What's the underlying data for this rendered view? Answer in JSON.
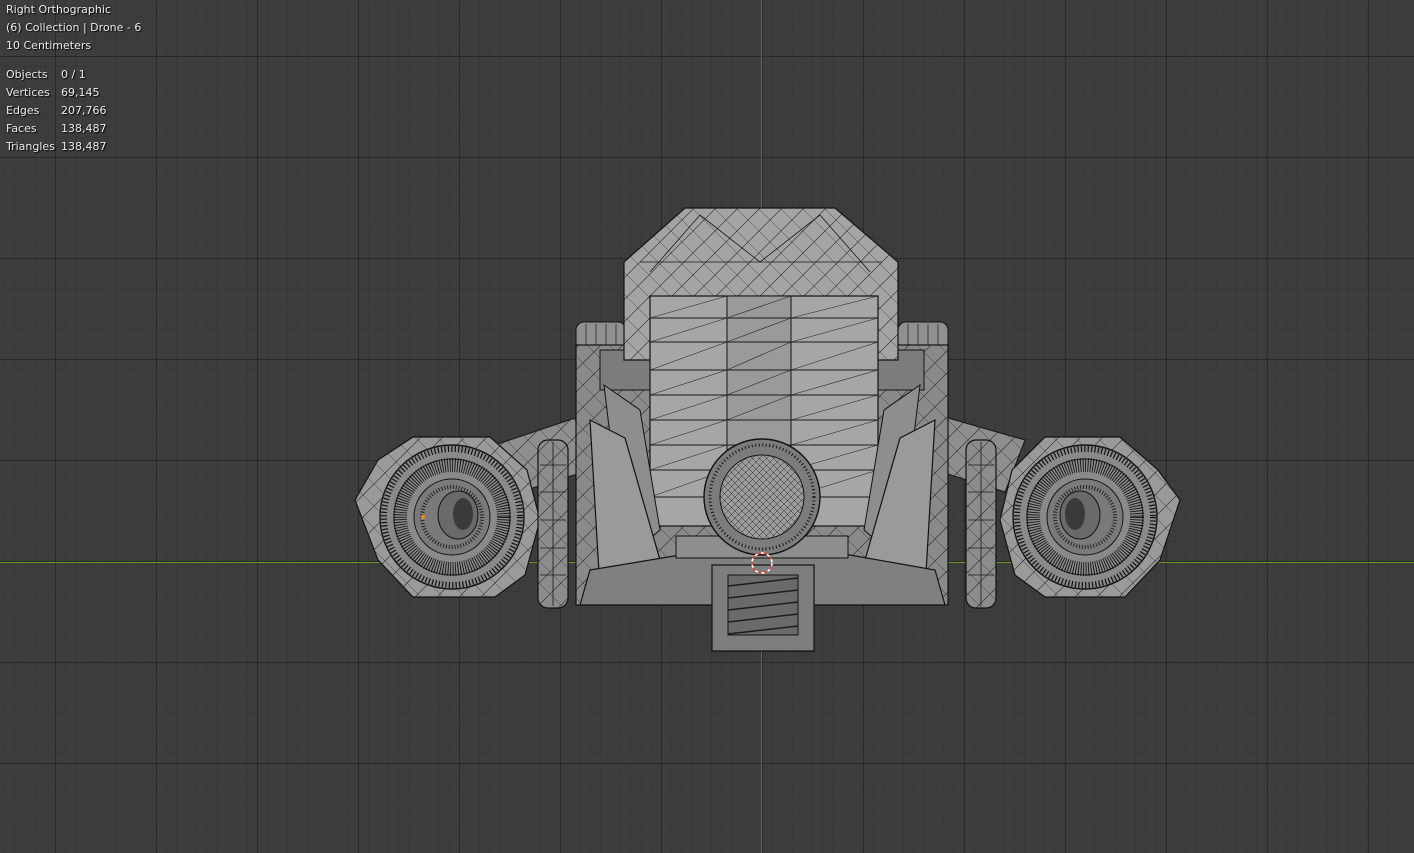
{
  "overlay": {
    "view_name": "Right Orthographic",
    "collection_line": "(6) Collection | Drone - 6",
    "scale_line": "10 Centimeters"
  },
  "stats": [
    {
      "label": "Objects",
      "value": "0 / 1"
    },
    {
      "label": "Vertices",
      "value": "69,145"
    },
    {
      "label": "Edges",
      "value": "207,766"
    },
    {
      "label": "Faces",
      "value": "138,487"
    },
    {
      "label": "Triangles",
      "value": "138,487"
    }
  ],
  "colors": {
    "background": "#3d3d3d",
    "grid_major": "#2a2a2a",
    "grid_minor": "#373737",
    "axis_x": "#6a9a26",
    "axis_z": "#3d6fa8",
    "mesh_fill": "#9c9c9c",
    "mesh_shadow": "#585858",
    "wire": "#161616",
    "cursor": "#d84a3a"
  }
}
